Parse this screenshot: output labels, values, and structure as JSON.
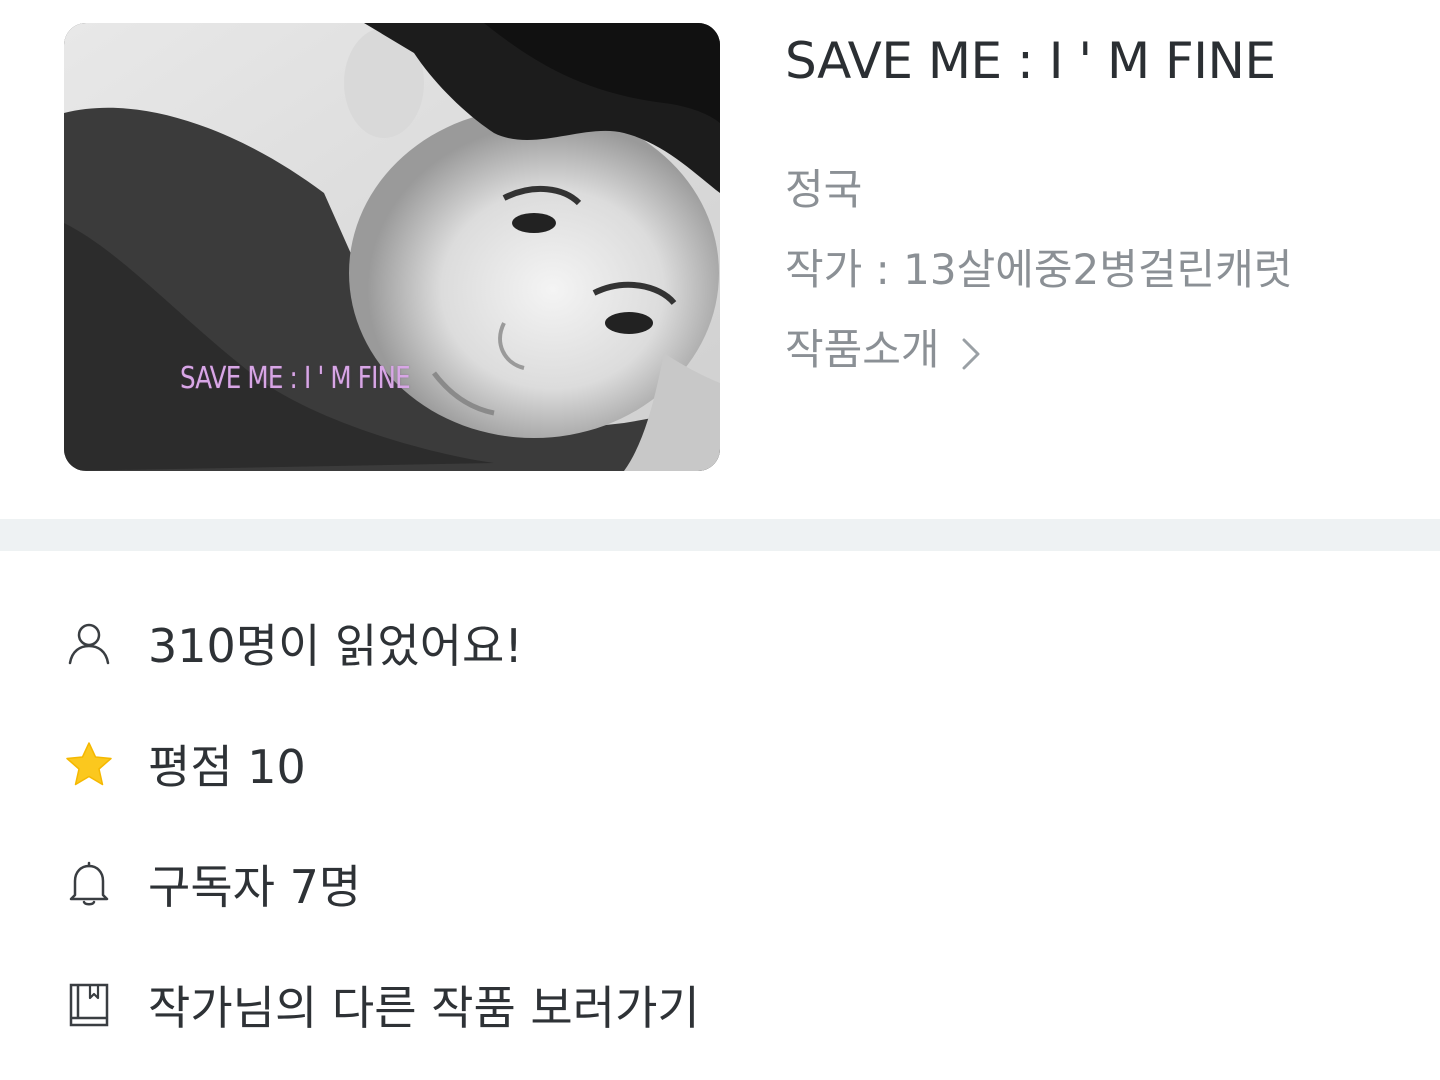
{
  "work": {
    "title": "SAVE ME : I ' M FINE",
    "cover_caption": "SAVE ME : I ' M FINE",
    "genre": "정국",
    "author": "작가 : 13살에중2병걸린캐럿",
    "intro_link": "작품소개"
  },
  "stats": {
    "readers": "310명이 읽었어요!",
    "rating": "평점 10",
    "subscribers": "구독자 7명",
    "other_works": "작가님의 다른 작품 보러가기"
  },
  "icons": {
    "readers": "person-icon",
    "rating": "star-icon",
    "subscribers": "bell-icon",
    "other_works": "book-icon",
    "intro": "chevron-right-icon"
  },
  "colors": {
    "title": "#2b2f33",
    "meta": "#8b9095",
    "separator": "#eef2f3",
    "star": "#fbc81e",
    "caption": "#d8a6e6"
  }
}
